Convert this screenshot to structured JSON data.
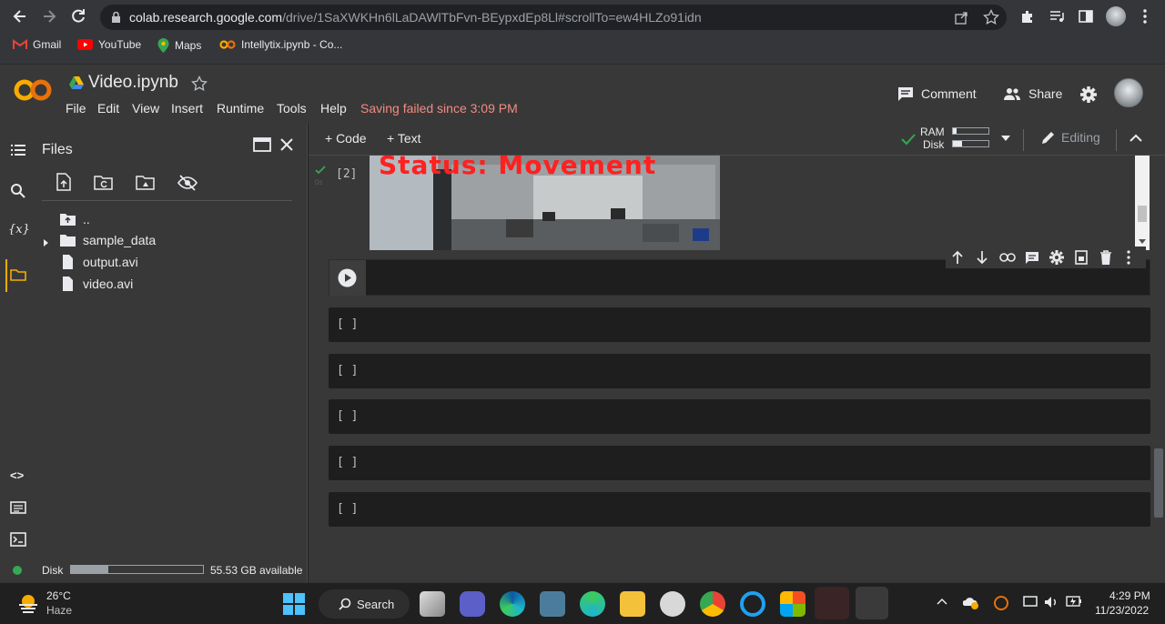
{
  "browser": {
    "url_host": "colab.research.google.com",
    "url_path": "/drive/1SaXWKHn6lLaDAWlTbFvn-BEypxdEp8Ll#scrollTo=ew4HLZo91idn",
    "bookmarks": [
      "Gmail",
      "YouTube",
      "Maps",
      "Intellytix.ipynb - Co..."
    ]
  },
  "header": {
    "logo": "CO",
    "title": "Video.ipynb",
    "menu": [
      "File",
      "Edit",
      "View",
      "Insert",
      "Runtime",
      "Tools",
      "Help"
    ],
    "save_status": "Saving failed since 3:09 PM",
    "comment_label": "Comment",
    "share_label": "Share"
  },
  "files": {
    "title": "Files",
    "tree": [
      {
        "name": "..",
        "type": "up-folder"
      },
      {
        "name": "sample_data",
        "type": "folder"
      },
      {
        "name": "output.avi",
        "type": "file"
      },
      {
        "name": "video.avi",
        "type": "file"
      }
    ],
    "disk_label": "Disk",
    "disk_available": "55.53 GB available",
    "disk_used_fraction": 0.28
  },
  "toolbar": {
    "code_label": "+ Code",
    "text_label": "+ Text",
    "ram_label": "RAM",
    "disk_label": "Disk",
    "editing_label": "Editing"
  },
  "cells": {
    "output_cell": {
      "exec_label": "[2]",
      "exec_time": "0s",
      "overlay_text": "Status: Movement"
    },
    "empty": [
      "[ ]",
      "[ ]",
      "[ ]",
      "[ ]",
      "[ ]"
    ]
  },
  "taskbar": {
    "temperature": "26°C",
    "weather": "Haze",
    "search_label": "Search",
    "time": "4:29 PM",
    "date": "11/23/2022"
  },
  "colors": {
    "accent": "#f9ab00",
    "error": "#f28b82",
    "overlay_text": "#ff2020"
  }
}
